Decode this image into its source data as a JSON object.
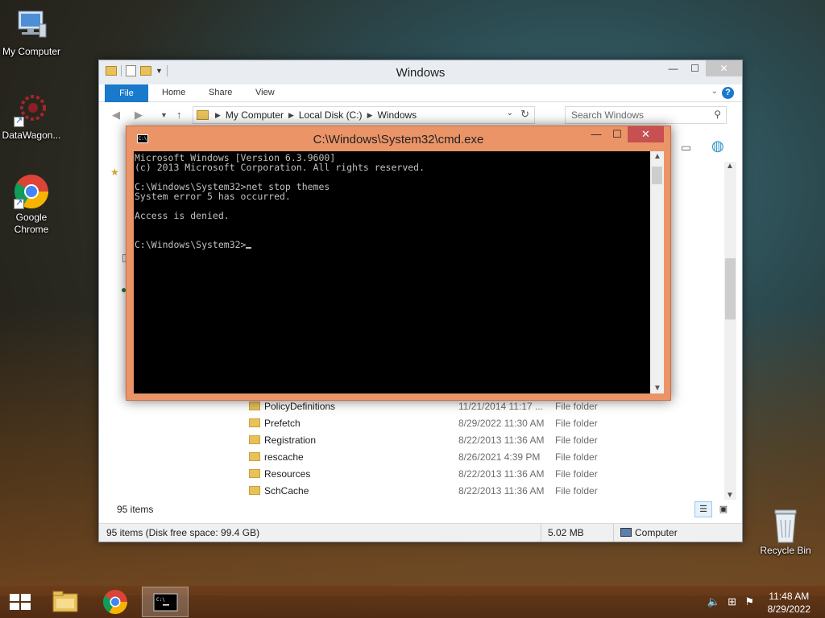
{
  "desktop": {
    "icons": [
      {
        "label": "My Computer",
        "icon": "computer-icon"
      },
      {
        "label": "DataWagon...",
        "icon": "datawagon-icon"
      },
      {
        "label": "Google Chrome",
        "icon": "chrome-icon"
      },
      {
        "label": "Recycle Bin",
        "icon": "recycle-bin-icon"
      }
    ]
  },
  "explorer": {
    "title": "Windows",
    "ribbon": {
      "file": "File",
      "home": "Home",
      "share": "Share",
      "view": "View"
    },
    "address": {
      "crumbs": [
        "My Computer",
        "Local Disk (C:)",
        "Windows"
      ]
    },
    "search_placeholder": "Search Windows",
    "files": [
      {
        "name": "PolicyDefinitions",
        "date": "11/21/2014 11:17 ...",
        "type": "File folder"
      },
      {
        "name": "Prefetch",
        "date": "8/29/2022 11:30 AM",
        "type": "File folder"
      },
      {
        "name": "Registration",
        "date": "8/22/2013 11:36 AM",
        "type": "File folder"
      },
      {
        "name": "rescache",
        "date": "8/26/2021 4:39 PM",
        "type": "File folder"
      },
      {
        "name": "Resources",
        "date": "8/22/2013 11:36 AM",
        "type": "File folder"
      },
      {
        "name": "SchCache",
        "date": "8/22/2013 11:36 AM",
        "type": "File folder"
      }
    ],
    "items_count": "95 items",
    "status": {
      "left": "95 items (Disk free space: 99.4 GB)",
      "size": "5.02 MB",
      "location": "Computer"
    }
  },
  "cmd": {
    "title": "C:\\Windows\\System32\\cmd.exe",
    "lines": [
      "Microsoft Windows [Version 6.3.9600]",
      "(c) 2013 Microsoft Corporation. All rights reserved.",
      "",
      "C:\\Windows\\System32>net stop themes",
      "System error 5 has occurred.",
      "",
      "Access is denied.",
      "",
      ""
    ],
    "prompt": "C:\\Windows\\System32>"
  },
  "taskbar": {
    "time": "11:48 AM",
    "date": "8/29/2022"
  },
  "colors": {
    "cmd_frame": "#eb9468",
    "ribbon_file": "#1979ca",
    "close_active": "#c75050"
  }
}
